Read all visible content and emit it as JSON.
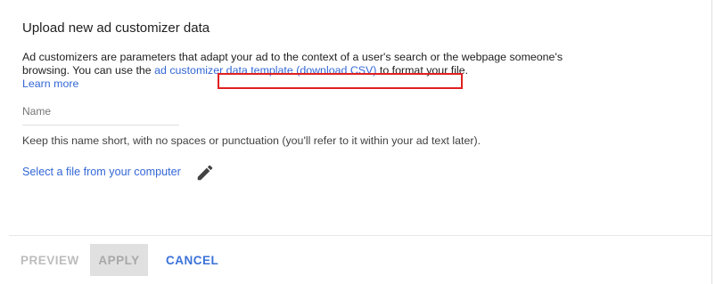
{
  "dialog": {
    "title": "Upload new ad customizer data",
    "description_part1": "Ad customizers are parameters that adapt your ad to the context of a user's search or the webpage someone's browsing. You can use the ",
    "template_link": "ad customizer data template (download CSV)",
    "description_part2": " to format your file.",
    "learn_more": "Learn more",
    "name_field_placeholder": "Name",
    "name_hint": "Keep this name short, with no spaces or punctuation (you'll refer to it within your ad text later).",
    "select_file": "Select a file from your computer",
    "edit_icon": "pencil-icon"
  },
  "actions": {
    "preview": "PREVIEW",
    "apply": "APPLY",
    "cancel": "CANCEL"
  },
  "colors": {
    "link": "#3367d6",
    "highlight": "#e02020",
    "disabled": "#bdbdbd"
  }
}
